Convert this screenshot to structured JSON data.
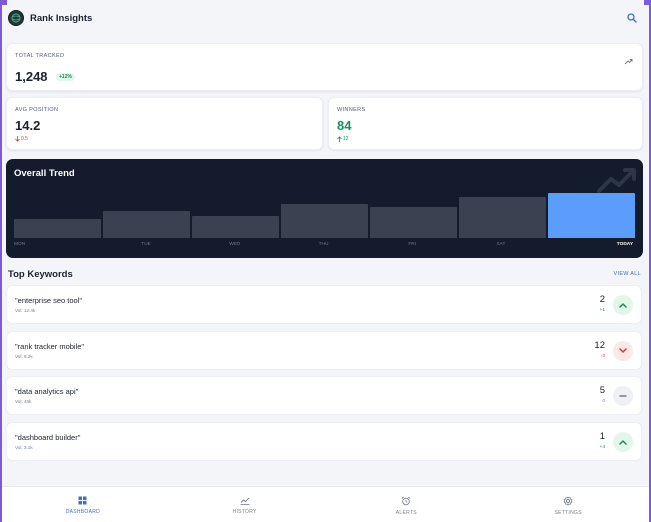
{
  "app": {
    "title": "Rank Insights",
    "logo_icon": "globe-logo-icon",
    "search_icon": "search-icon"
  },
  "colors": {
    "accent": "#3b6fd6",
    "positive": "#17915a",
    "negative": "#d33a3a",
    "chart_bg": "#131b2c",
    "bar": "#3a4252",
    "bar_active": "#5b9dfb"
  },
  "stats": {
    "total": {
      "label": "TOTAL TRACKED",
      "value": "1,248",
      "badge": "+12%",
      "icon": "link-icon"
    },
    "avg": {
      "label": "AVG POSITION",
      "value": "14.2",
      "delta": "0.5",
      "delta_icon": "arrow-down-icon"
    },
    "winners": {
      "label": "WINNERS",
      "value": "84",
      "delta": "12",
      "delta_icon": "arrow-up-icon"
    }
  },
  "trend": {
    "title": "Overall Trend",
    "icon": "trending-up-icon"
  },
  "chart_data": {
    "type": "bar",
    "title": "Overall Trend",
    "categories": [
      "MON",
      "TUE",
      "WED",
      "THU",
      "FRI",
      "SAT",
      "TODAY"
    ],
    "values": [
      42,
      60,
      48,
      75,
      70,
      92,
      100
    ],
    "ylim": [
      0,
      100
    ],
    "highlight": "TODAY",
    "grid": false
  },
  "keywords": {
    "title": "Top Keywords",
    "view_all": "VIEW ALL",
    "items": [
      {
        "name": "\"enterprise seo tool\"",
        "vol": "Vol: 12.4k",
        "rank": "2",
        "change": "+1",
        "trend": "up"
      },
      {
        "name": "\"rank tracker mobile\"",
        "vol": "Vol: 8.2k",
        "rank": "12",
        "change": "-3",
        "trend": "down"
      },
      {
        "name": "\"data analytics api\"",
        "vol": "Vol: 45k",
        "rank": "5",
        "change": "0",
        "trend": "flat"
      },
      {
        "name": "\"dashboard builder\"",
        "vol": "Vol: 3.1k",
        "rank": "1",
        "change": "+4",
        "trend": "up"
      }
    ]
  },
  "nav": [
    {
      "label": "DASHBOARD",
      "icon": "dashboard-grid-icon",
      "active": true
    },
    {
      "label": "HISTORY",
      "icon": "history-chart-icon",
      "active": false
    },
    {
      "label": "ALERTS",
      "icon": "alarm-clock-icon",
      "active": false
    },
    {
      "label": "SETTINGS",
      "icon": "gear-icon",
      "active": false
    }
  ]
}
